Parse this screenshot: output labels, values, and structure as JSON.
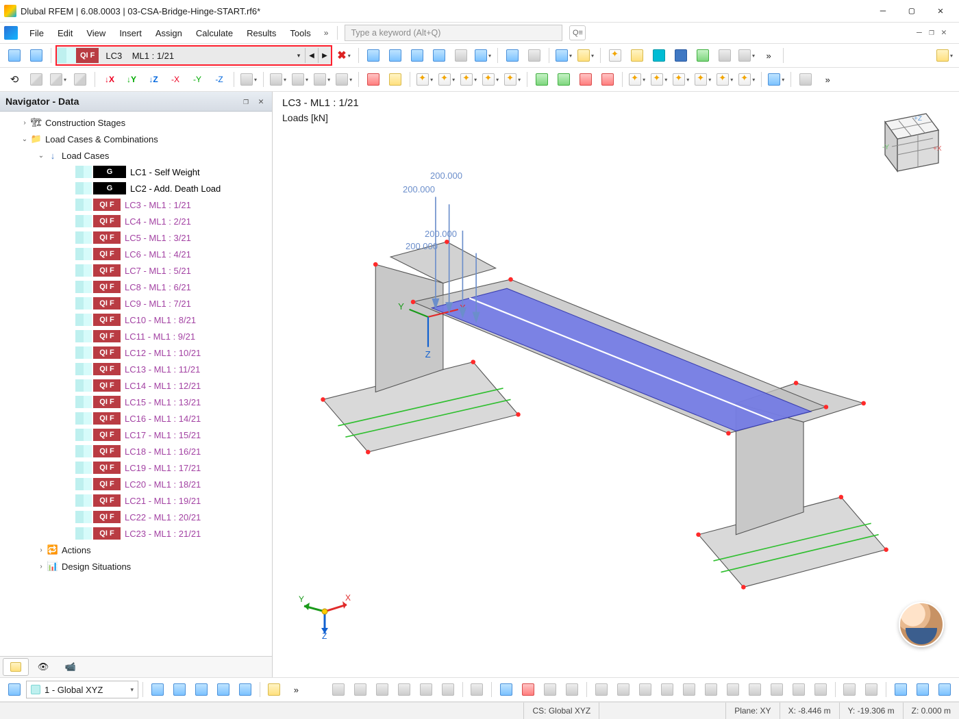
{
  "window": {
    "title": "Dlubal RFEM | 6.08.0003 | 03-CSA-Bridge-Hinge-START.rf6*"
  },
  "menu": {
    "items": [
      "File",
      "Edit",
      "View",
      "Insert",
      "Assign",
      "Calculate",
      "Results",
      "Tools"
    ],
    "search_placeholder": "Type a keyword (Alt+Q)"
  },
  "loadcase_selector": {
    "tag": "QI F",
    "code": "LC3",
    "name": "ML1 : 1/21"
  },
  "navigator": {
    "title": "Navigator - Data",
    "nodes": {
      "construction_stages": "Construction Stages",
      "load_cases_comb": "Load Cases & Combinations",
      "load_cases": "Load Cases",
      "actions": "Actions",
      "design_situations": "Design Situations"
    },
    "load_cases": [
      {
        "tag": "G",
        "style": "g",
        "label": "LC1 - Self Weight",
        "cls": "dark"
      },
      {
        "tag": "G",
        "style": "g",
        "label": "LC2 - Add. Death Load",
        "cls": "dark"
      },
      {
        "tag": "QI F",
        "style": "qif",
        "label": "LC3 - ML1 : 1/21",
        "cls": "purple"
      },
      {
        "tag": "QI F",
        "style": "qif",
        "label": "LC4 - ML1 : 2/21",
        "cls": "purple"
      },
      {
        "tag": "QI F",
        "style": "qif",
        "label": "LC5 - ML1 : 3/21",
        "cls": "purple"
      },
      {
        "tag": "QI F",
        "style": "qif",
        "label": "LC6 - ML1 : 4/21",
        "cls": "purple"
      },
      {
        "tag": "QI F",
        "style": "qif",
        "label": "LC7 - ML1 : 5/21",
        "cls": "purple"
      },
      {
        "tag": "QI F",
        "style": "qif",
        "label": "LC8 - ML1 : 6/21",
        "cls": "purple"
      },
      {
        "tag": "QI F",
        "style": "qif",
        "label": "LC9 - ML1 : 7/21",
        "cls": "purple"
      },
      {
        "tag": "QI F",
        "style": "qif",
        "label": "LC10 - ML1 : 8/21",
        "cls": "purple"
      },
      {
        "tag": "QI F",
        "style": "qif",
        "label": "LC11 - ML1 : 9/21",
        "cls": "purple"
      },
      {
        "tag": "QI F",
        "style": "qif",
        "label": "LC12 - ML1 : 10/21",
        "cls": "purple"
      },
      {
        "tag": "QI F",
        "style": "qif",
        "label": "LC13 - ML1 : 11/21",
        "cls": "purple"
      },
      {
        "tag": "QI F",
        "style": "qif",
        "label": "LC14 - ML1 : 12/21",
        "cls": "purple"
      },
      {
        "tag": "QI F",
        "style": "qif",
        "label": "LC15 - ML1 : 13/21",
        "cls": "purple"
      },
      {
        "tag": "QI F",
        "style": "qif",
        "label": "LC16 - ML1 : 14/21",
        "cls": "purple"
      },
      {
        "tag": "QI F",
        "style": "qif",
        "label": "LC17 - ML1 : 15/21",
        "cls": "purple"
      },
      {
        "tag": "QI F",
        "style": "qif",
        "label": "LC18 - ML1 : 16/21",
        "cls": "purple"
      },
      {
        "tag": "QI F",
        "style": "qif",
        "label": "LC19 - ML1 : 17/21",
        "cls": "purple"
      },
      {
        "tag": "QI F",
        "style": "qif",
        "label": "LC20 - ML1 : 18/21",
        "cls": "purple"
      },
      {
        "tag": "QI F",
        "style": "qif",
        "label": "LC21 - ML1 : 19/21",
        "cls": "purple"
      },
      {
        "tag": "QI F",
        "style": "qif",
        "label": "LC22 - ML1 : 20/21",
        "cls": "purple"
      },
      {
        "tag": "QI F",
        "style": "qif",
        "label": "LC23 - ML1 : 21/21",
        "cls": "purple"
      }
    ]
  },
  "viewport": {
    "title": "LC3 - ML1 : 1/21",
    "subtitle": "Loads [kN]",
    "load_values": [
      "200.000",
      "200.000",
      "200.000",
      "200.000"
    ]
  },
  "bottom_combo": {
    "label": "1 - Global XYZ"
  },
  "status": {
    "cs": "CS: Global XYZ",
    "plane": "Plane: XY",
    "x": "X: -8.446 m",
    "y": "Y: -19.306 m",
    "z": "Z: 0.000 m"
  }
}
